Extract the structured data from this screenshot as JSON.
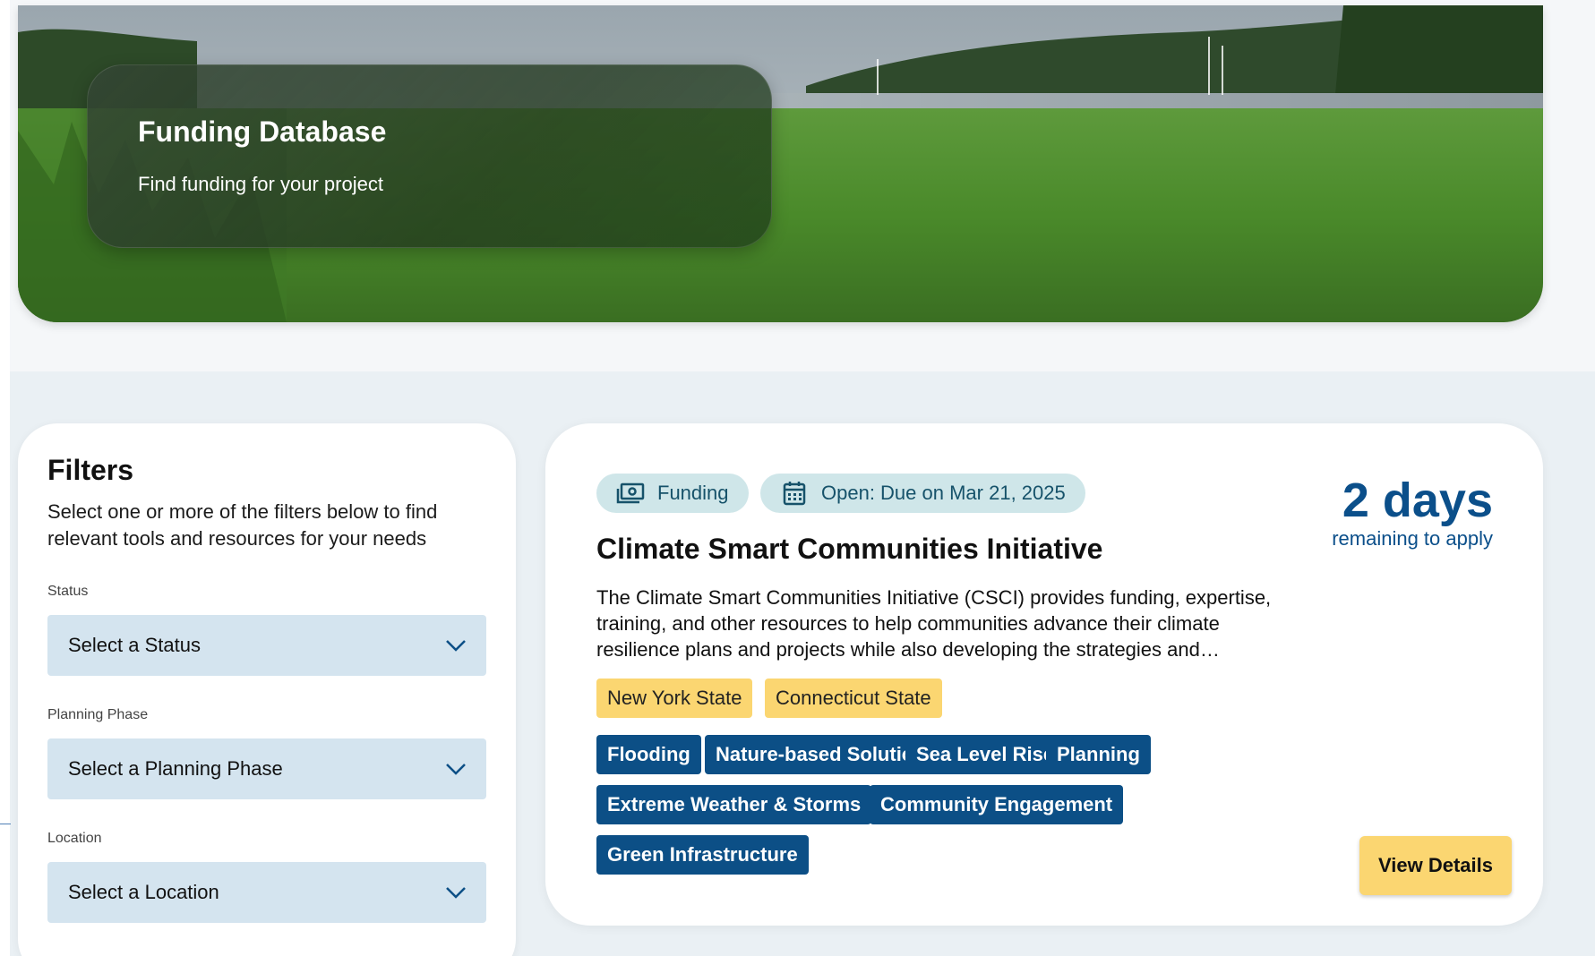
{
  "hero": {
    "title": "Funding Database",
    "subtitle": "Find funding for your project"
  },
  "filters": {
    "title": "Filters",
    "description": "Select one or more of the filters below to find relevant tools and resources for your needs",
    "fields": [
      {
        "label": "Status",
        "value": "Select a Status"
      },
      {
        "label": "Planning Phase",
        "value": "Select a Planning Phase"
      },
      {
        "label": "Location",
        "value": "Select a Location"
      }
    ]
  },
  "card": {
    "type_pill": {
      "label": "Funding",
      "icon": "money-icon"
    },
    "status_pill": {
      "label": "Open: Due on Mar 21, 2025",
      "icon": "calendar-icon"
    },
    "title": "Climate Smart Communities Initiative",
    "description": "The Climate Smart Communities Initiative (CSCI) provides funding, expertise, training, and other resources to help communities advance their climate resilience plans and projects while also developing the strategies and…",
    "days_remaining": "2 days",
    "days_caption": "remaining to apply",
    "locations": [
      "New York State",
      "Connecticut State"
    ],
    "topics": [
      "Flooding",
      "Nature-based Solutions",
      "Sea Level Rise",
      "Planning",
      "Extreme Weather & Storms",
      "Community Engagement",
      "Green Infrastructure"
    ],
    "view_button": "View Details"
  },
  "colors": {
    "primary": "#0c4f86",
    "accent_yellow": "#fbd671",
    "pill_bg": "#cfe6e9",
    "select_bg": "#d4e4ef"
  }
}
